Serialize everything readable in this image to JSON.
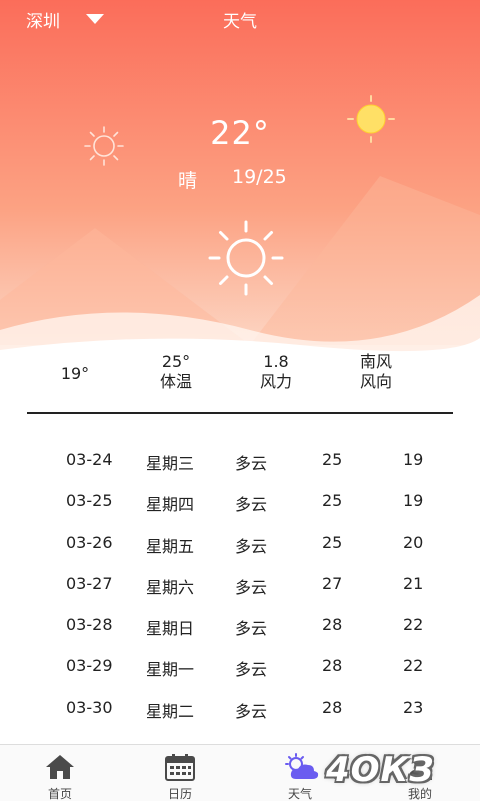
{
  "header": {
    "city": "深圳",
    "title": "天气"
  },
  "current": {
    "temperature": "22°",
    "condition": "晴",
    "range": "19/25"
  },
  "stats": [
    {
      "value": "19°",
      "label": ""
    },
    {
      "value": "25°",
      "label": "体温"
    },
    {
      "value": "1.8",
      "label": "风力"
    },
    {
      "value": "南风",
      "label": "风向"
    }
  ],
  "forecast": [
    {
      "date": "03-24",
      "weekday": "星期三",
      "condition": "多云",
      "high": "25",
      "low": "19"
    },
    {
      "date": "03-25",
      "weekday": "星期四",
      "condition": "多云",
      "high": "25",
      "low": "19"
    },
    {
      "date": "03-26",
      "weekday": "星期五",
      "condition": "多云",
      "high": "25",
      "low": "20"
    },
    {
      "date": "03-27",
      "weekday": "星期六",
      "condition": "多云",
      "high": "27",
      "low": "21"
    },
    {
      "date": "03-28",
      "weekday": "星期日",
      "condition": "多云",
      "high": "28",
      "low": "22"
    },
    {
      "date": "03-29",
      "weekday": "星期一",
      "condition": "多云",
      "high": "28",
      "low": "22"
    },
    {
      "date": "03-30",
      "weekday": "星期二",
      "condition": "多云",
      "high": "28",
      "low": "23"
    }
  ],
  "nav": [
    {
      "label": "首页",
      "icon": "home-icon"
    },
    {
      "label": "日历",
      "icon": "calendar-icon"
    },
    {
      "label": "天气",
      "icon": "weather-icon"
    },
    {
      "label": "我的",
      "icon": "profile-icon"
    }
  ],
  "watermark": "4ОКЗ",
  "colors": {
    "gradient_top": "#fb6f5c",
    "gradient_bottom": "#fde0d0",
    "sun_yellow": "#ffe066",
    "active_nav": "#6a5cf0"
  }
}
